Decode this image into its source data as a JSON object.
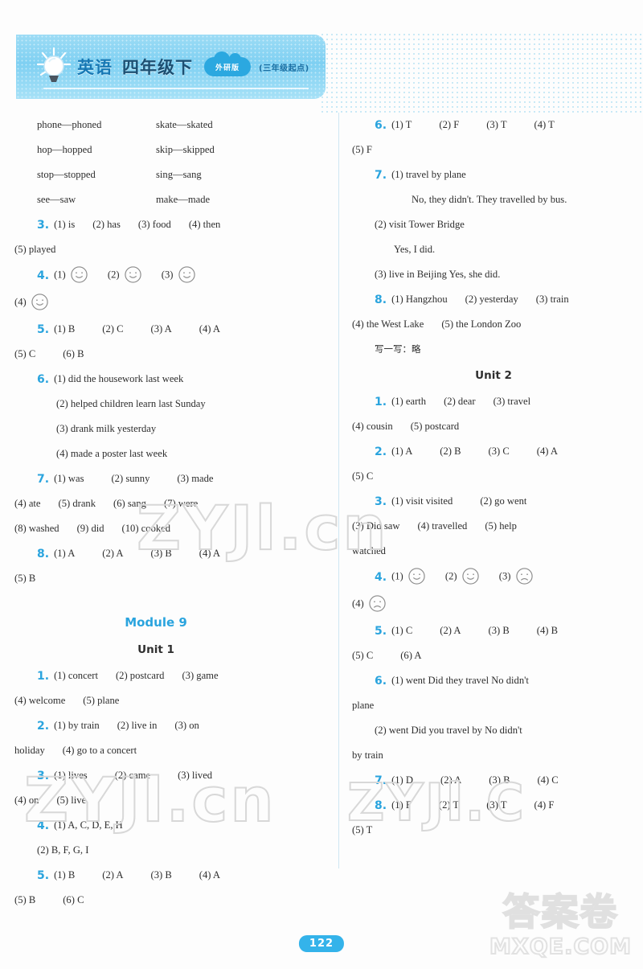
{
  "header": {
    "subject": "英语",
    "grade": "四年级下",
    "publisher_badge": "外研版",
    "edition_note": "(三年级起点)",
    "bulb_icon": "lightbulb-icon",
    "accent_color": "#2aa4de",
    "banner_color": "#7fd0f2"
  },
  "page_number": "122",
  "watermarks": {
    "site_a": "ZYJl.cn",
    "site_b": "ZYJl.C",
    "corner_cn": "答案卷",
    "corner_en": "MXQE.COM"
  },
  "left_column": {
    "verbs": [
      {
        "a": "phone—phoned",
        "b": "skate—skated"
      },
      {
        "a": "hop—hopped",
        "b": "skip—skipped"
      },
      {
        "a": "stop—stopped",
        "b": "sing—sang"
      },
      {
        "a": "see—saw",
        "b": "make—made"
      }
    ],
    "q3": {
      "num": "3.",
      "line1": [
        "(1) is",
        "(2) has",
        "(3) food",
        "(4) then"
      ],
      "line2": [
        "(5) played"
      ]
    },
    "q4": {
      "num": "4.",
      "items": [
        {
          "label": "(1)",
          "face": "smile"
        },
        {
          "label": "(2)",
          "face": "smile"
        },
        {
          "label": "(3)",
          "face": "smile"
        },
        {
          "label": "(4)",
          "face": "smile"
        }
      ]
    },
    "q5": {
      "num": "5.",
      "line1": [
        "(1) B",
        "(2) C",
        "(3) A",
        "(4) A"
      ],
      "line2": [
        "(5) C",
        "(6) B"
      ]
    },
    "q6": {
      "num": "6.",
      "lines": [
        "(1) did the housework last week",
        "(2) helped children learn last Sunday",
        "(3) drank milk yesterday",
        "(4) made a poster last week"
      ]
    },
    "q7": {
      "num": "7.",
      "line1": [
        "(1) was",
        "(2) sunny",
        "(3) made"
      ],
      "line2": [
        "(4) ate",
        "(5) drank",
        "(6) sang",
        "(7) were"
      ],
      "line3": [
        "(8) washed",
        "(9) did",
        "(10) cooked"
      ]
    },
    "q8": {
      "num": "8.",
      "line1": [
        "(1) A",
        "(2) A",
        "(3) B",
        "(4) A"
      ],
      "line2": [
        "(5) B"
      ]
    },
    "module_heading": "Module 9",
    "unit_heading": "Unit 1",
    "u1_q1": {
      "num": "1.",
      "line1": [
        "(1) concert",
        "(2) postcard",
        "(3) game"
      ],
      "line2": [
        "(4) welcome",
        "(5) plane"
      ]
    },
    "u1_q2": {
      "num": "2.",
      "line1": [
        "(1) by train",
        "(2) live in",
        "(3) on"
      ],
      "line2": [
        "holiday",
        "(4) go to a concert"
      ]
    },
    "u1_q3": {
      "num": "3.",
      "line1": [
        "(1) lives",
        "(2) came",
        "(3) lived"
      ],
      "line2": [
        "(4) on",
        "(5) live"
      ]
    },
    "u1_q4": {
      "num": "4.",
      "line1": [
        "(1) A, C, D, E, H"
      ],
      "line2": [
        "(2) B, F, G, I"
      ]
    },
    "u1_q5": {
      "num": "5.",
      "line1": [
        "(1) B",
        "(2) A",
        "(3) B",
        "(4) A"
      ],
      "line2": [
        "(5) B",
        "(6) C"
      ]
    }
  },
  "right_column": {
    "q6": {
      "num": "6.",
      "line1": [
        "(1) T",
        "(2) F",
        "(3) T",
        "(4) T"
      ],
      "line2": [
        "(5) F"
      ]
    },
    "q7": {
      "num": "7.",
      "lines": [
        "(1) travel by plane",
        "No, they didn't. They travelled by bus.",
        "(2) visit Tower Bridge",
        "Yes, I did.",
        "(3) live in Beijing   Yes, she did."
      ]
    },
    "q8": {
      "num": "8.",
      "line1": [
        "(1) Hangzhou",
        "(2) yesterday",
        "(3) train"
      ],
      "line2": [
        "(4) the West Lake",
        "(5) the London Zoo"
      ]
    },
    "write_note": "写一写：略",
    "unit_heading": "Unit 2",
    "u2_q1": {
      "num": "1.",
      "line1": [
        "(1) earth",
        "(2) dear",
        "(3) travel"
      ],
      "line2": [
        "(4) cousin",
        "(5) postcard"
      ]
    },
    "u2_q2": {
      "num": "2.",
      "line1": [
        "(1) A",
        "(2) B",
        "(3) C",
        "(4) A"
      ],
      "line2": [
        "(5) C"
      ]
    },
    "u2_q3": {
      "num": "3.",
      "line1": [
        "(1) visit  visited",
        "(2) go  went"
      ],
      "line2": [
        "(3) Did  saw",
        "(4) travelled",
        "(5) help"
      ],
      "line3": [
        "watched"
      ]
    },
    "u2_q4": {
      "num": "4.",
      "items": [
        {
          "label": "(1)",
          "face": "smile"
        },
        {
          "label": "(2)",
          "face": "smile"
        },
        {
          "label": "(3)",
          "face": "sad"
        },
        {
          "label": "(4)",
          "face": "sad"
        }
      ]
    },
    "u2_q5": {
      "num": "5.",
      "line1": [
        "(1) C",
        "(2) A",
        "(3) B",
        "(4) B"
      ],
      "line2": [
        "(5) C",
        "(6) A"
      ]
    },
    "u2_q6": {
      "num": "6.",
      "lines": [
        "(1) went   Did they travel   No   didn't",
        "plane",
        "(2) went   Did you travel by   No   didn't",
        "by train"
      ]
    },
    "u2_q7": {
      "num": "7.",
      "line1": [
        "(1) D",
        "(2) A",
        "(3) B",
        "(4) C"
      ]
    },
    "u2_q8": {
      "num": "8.",
      "line1": [
        "(1) F",
        "(2) T",
        "(3) T",
        "(4) F"
      ],
      "line2": [
        "(5) T"
      ]
    }
  }
}
